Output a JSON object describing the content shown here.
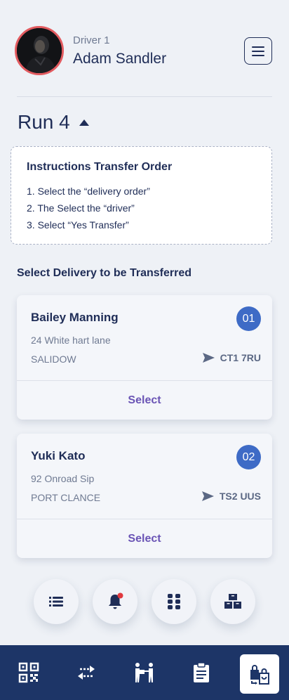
{
  "header": {
    "driver_label": "Driver 1",
    "driver_name": "Adam Sandler",
    "menu_icon": "hamburger-menu-icon"
  },
  "run": {
    "title": "Run 4",
    "toggle_icon": "caret-up-icon"
  },
  "instructions": {
    "title": "Instructions Transfer Order",
    "steps": [
      "1. Select the “delivery order”",
      "2. The Select the “driver”",
      "3. Select “Yes Transfer”"
    ]
  },
  "section_title": "Select Delivery to be Transferred",
  "deliveries": [
    {
      "name": "Bailey Manning",
      "number": "01",
      "address": "24 White hart lane",
      "city": "SALIDOW",
      "postcode": "CT1 7RU",
      "select_label": "Select"
    },
    {
      "name": "Yuki Kato",
      "number": "02",
      "address": "92 Onroad Sip",
      "city": "PORT CLANCE",
      "postcode": "TS2 UUS",
      "select_label": "Select"
    }
  ],
  "quick_actions": [
    "list-icon",
    "bell-notification-icon",
    "grid-icon",
    "boxes-icon"
  ],
  "bottom_nav": [
    "qr-code-icon",
    "transfer-arrows-icon",
    "delivery-person-icon",
    "clipboard-icon",
    "package-bags-icon"
  ],
  "colors": {
    "background": "#eef1f6",
    "primary_text": "#1f2d57",
    "badge": "#3e6bc6",
    "select_text": "#6a54b5",
    "nav_bar": "#1d3567",
    "avatar_ring": "#e25a5f",
    "notification_dot": "#e0383e"
  }
}
